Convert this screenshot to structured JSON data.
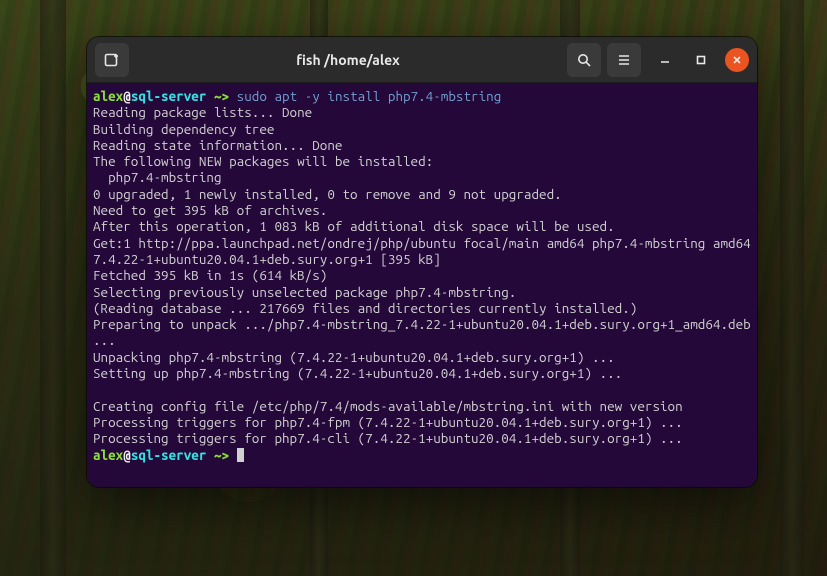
{
  "window": {
    "title": "fish /home/alex"
  },
  "prompt": {
    "user": "alex",
    "at": "@",
    "host": "sql-server",
    "sep": " ~> "
  },
  "command": {
    "cmd1": "sudo",
    "cmd2": " apt -y install php7.4-mbstring"
  },
  "out": {
    "l1": "Reading package lists... Done",
    "l2": "Building dependency tree",
    "l3": "Reading state information... Done",
    "l4": "The following NEW packages will be installed:",
    "l5": "  php7.4-mbstring",
    "l6": "0 upgraded, 1 newly installed, 0 to remove and 9 not upgraded.",
    "l7": "Need to get 395 kB of archives.",
    "l8": "After this operation, 1 083 kB of additional disk space will be used.",
    "l9": "Get:1 http://ppa.launchpad.net/ondrej/php/ubuntu focal/main amd64 php7.4-mbstring amd64 7.4.22-1+ubuntu20.04.1+deb.sury.org+1 [395 kB]",
    "l10": "Fetched 395 kB in 1s (614 kB/s)",
    "l11": "Selecting previously unselected package php7.4-mbstring.",
    "l12": "(Reading database ... 217669 files and directories currently installed.)",
    "l13": "Preparing to unpack .../php7.4-mbstring_7.4.22-1+ubuntu20.04.1+deb.sury.org+1_amd64.deb ...",
    "l14": "Unpacking php7.4-mbstring (7.4.22-1+ubuntu20.04.1+deb.sury.org+1) ...",
    "l15": "Setting up php7.4-mbstring (7.4.22-1+ubuntu20.04.1+deb.sury.org+1) ...",
    "l16": "",
    "l17": "Creating config file /etc/php/7.4/mods-available/mbstring.ini with new version",
    "l18": "Processing triggers for php7.4-fpm (7.4.22-1+ubuntu20.04.1+deb.sury.org+1) ...",
    "l19": "Processing triggers for php7.4-cli (7.4.22-1+ubuntu20.04.1+deb.sury.org+1) ..."
  }
}
